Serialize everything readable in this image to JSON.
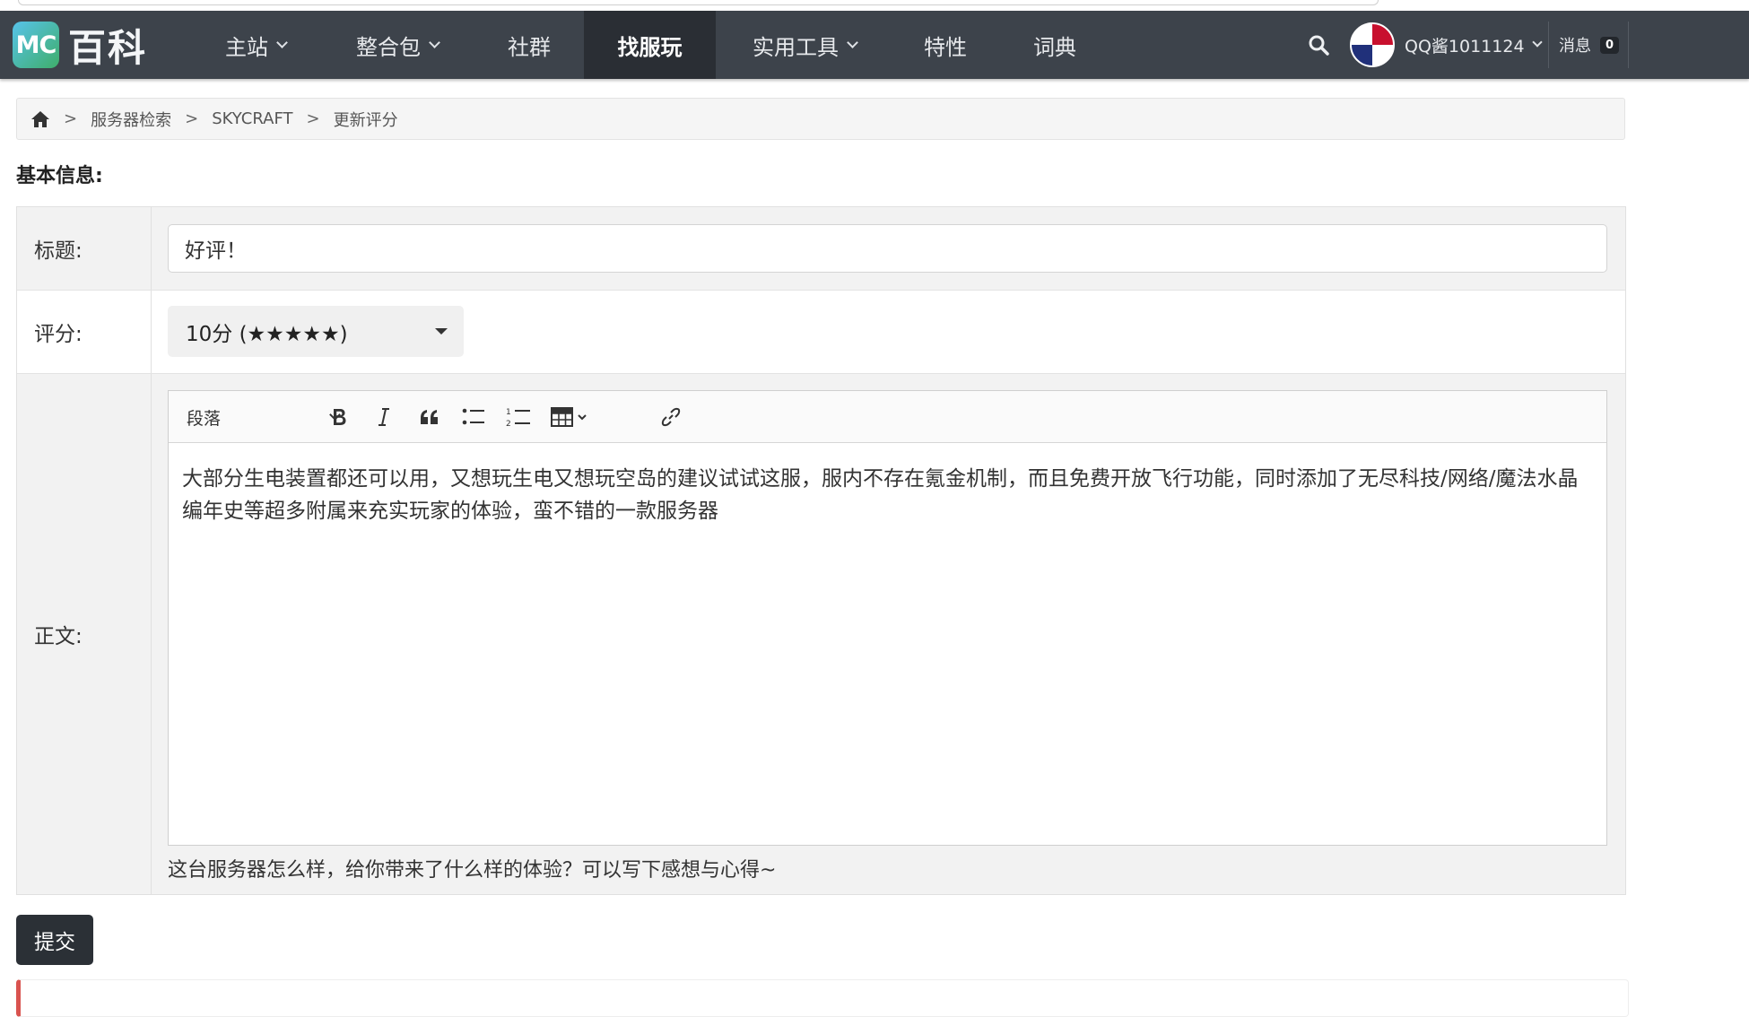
{
  "logo": {
    "mc": "MC",
    "text": "百科"
  },
  "nav": {
    "items": [
      {
        "label": "主站",
        "dropdown": true
      },
      {
        "label": "整合包",
        "dropdown": true
      },
      {
        "label": "社群",
        "dropdown": false
      },
      {
        "label": "找服玩",
        "dropdown": false,
        "active": true
      },
      {
        "label": "实用工具",
        "dropdown": true
      },
      {
        "label": "特性",
        "dropdown": false
      },
      {
        "label": "词典",
        "dropdown": false
      }
    ],
    "search_icon": "search-icon",
    "user_name": "QQ酱1011124",
    "messages_label": "消息",
    "messages_count": "0"
  },
  "breadcrumb": {
    "home_icon": "home-icon",
    "items": [
      "服务器检索",
      "SKYCRAFT",
      "更新评分"
    ],
    "separator": ">"
  },
  "section_title": "基本信息:",
  "form": {
    "title_label": "标题:",
    "title_value": "好评！",
    "score_label": "评分:",
    "score_value": "10分 (★★★★★)",
    "body_label": "正文:",
    "editor": {
      "paragraph_select": "段落",
      "tools": [
        "bold-icon",
        "italic-icon",
        "blockquote-icon",
        "bulleted-list-icon",
        "numbered-list-icon",
        "table-icon",
        "link-icon"
      ],
      "content": "大部分生电装置都还可以用，又想玩生电又想玩空岛的建议试试这服，服内不存在氪金机制，而且免费开放飞行功能，同时添加了无尽科技/网络/魔法水晶编年史等超多附属来充实玩家的体验，蛮不错的一款服务器"
    },
    "hint": "这台服务器怎么样，给你带来了什么样的体验？可以写下感想与心得~"
  },
  "submit_label": "提交",
  "colors": {
    "navbar_bg": "#3d434b",
    "navbar_active_bg": "#2a2e34",
    "submit_bg": "#2b3036",
    "alert_accent": "#d9534f"
  }
}
